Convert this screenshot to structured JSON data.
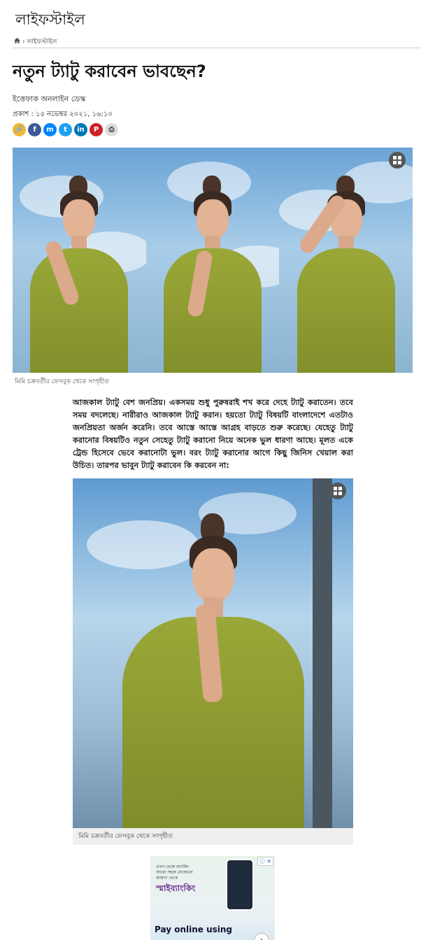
{
  "section": {
    "title": "লাইফস্টাইল"
  },
  "breadcrumb": {
    "home_icon": "home-icon",
    "separator": "›",
    "current": "লাইফস্টাইল"
  },
  "article": {
    "headline": "নতুন ট্যাটু করাবেন ভাবছেন?",
    "author": "ইত্তেফাক অনলাইন ডেস্ক",
    "published": "প্রকাশ : ১৫ নভেম্বর ২০২১, ১৬:১০",
    "body": "আজকাল ট্যাটু বেশ জনপ্রিয়। একসময় শুধু পুরুষরাই শখ করে দেহে ট্যাটু করাতেন। তবে সময় বদলেছে। নারীরাও আজকাল ট্যাটু করান। হয়তো ট্যাটু বিষয়টি বাংলাদেশে এতটাও জনপ্রিয়তা অর্জন করেনি। তবে আস্তে আস্তে আগ্রহ বাড়তে শুরু করেছে। যেহেতু ট্যাটু করানোর বিষয়টিও নতুন সেহেতু ট্যাটু করানো নিয়ে অনেক ভুল ধারণা আছে। মূলত একে ট্রেন্ড হিসেবে ভেবে করানোটা ভুল। বরং ট্যাটু করানোর আগে কিছু জিনিস খেয়াল করা উচিত। তারপর ভাবুন ট্যাটু করাবেন কি করবেন না:",
    "image1_caption": "মিমি চক্রবর্তীর ফেসবুক থেকে সংগৃহীত",
    "image2_caption": "মিমি চক্রবর্তীর ফেসবুক থেকে সংগৃহীত"
  },
  "share": [
    {
      "name": "copy-link",
      "icon": "link-icon",
      "glyph": "🔗",
      "color": "#f2b632"
    },
    {
      "name": "facebook",
      "icon": "facebook-icon",
      "glyph": "f",
      "color": "#3b5998"
    },
    {
      "name": "messenger",
      "icon": "messenger-icon",
      "glyph": "m",
      "color": "#0084ff"
    },
    {
      "name": "twitter",
      "icon": "twitter-icon",
      "glyph": "t",
      "color": "#1da1f2"
    },
    {
      "name": "linkedin",
      "icon": "linkedin-icon",
      "glyph": "in",
      "color": "#0077b5"
    },
    {
      "name": "pinterest",
      "icon": "pinterest-icon",
      "glyph": "P",
      "color": "#cb2027"
    },
    {
      "name": "print",
      "icon": "print-icon",
      "glyph": "⎙",
      "color": "#dddddd"
    }
  ],
  "ad": {
    "badge": "ⓘ ✕",
    "small_text": "এখন থেকে ব্যাংকিং আরো সহজ যেকোনো জায়গা থেকে",
    "brand": "স্মাইব্যাংকিং",
    "cta": "Pay online using",
    "arrow": "›"
  }
}
